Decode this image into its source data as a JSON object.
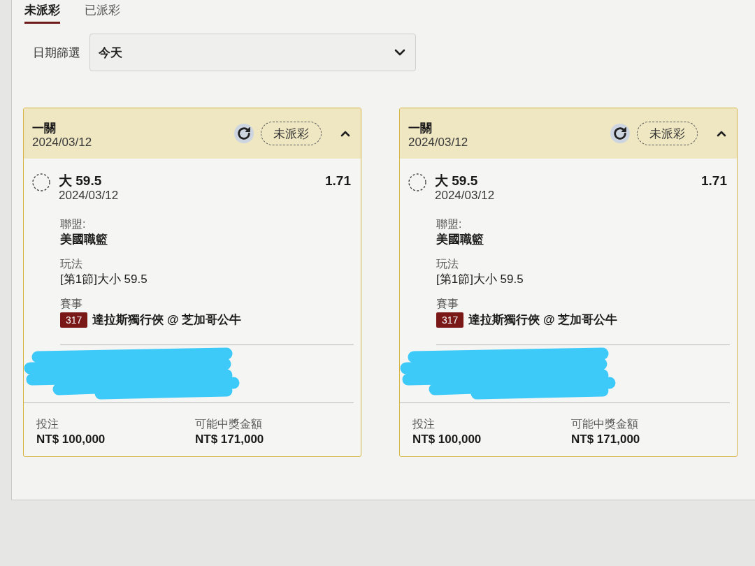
{
  "tabs": [
    {
      "label": "未派彩",
      "selected": true
    },
    {
      "label": "已派彩",
      "selected": false
    }
  ],
  "date_filter": {
    "label": "日期篩選",
    "value": "今天"
  },
  "bets": [
    {
      "title": "一關",
      "date": "2024/03/12",
      "status": "未派彩",
      "expanded": true,
      "selection": {
        "name": "大 59.5",
        "date": "2024/03/12",
        "odds": "1.71"
      },
      "details": [
        {
          "label": "聯盟:",
          "value": "美國職籃"
        },
        {
          "label": "玩法",
          "value": "[第1節]大小 59.5"
        },
        {
          "label": "賽事",
          "badge": "317",
          "value": "達拉斯獨行俠 @ 芝加哥公牛"
        }
      ],
      "redacted": true,
      "stake": {
        "label": "投注",
        "value": "NT$ 100,000"
      },
      "payout": {
        "label": "可能中獎金額",
        "value": "NT$ 171,000"
      }
    },
    {
      "title": "一關",
      "date": "2024/03/12",
      "status": "未派彩",
      "expanded": true,
      "selection": {
        "name": "大 59.5",
        "date": "2024/03/12",
        "odds": "1.71"
      },
      "details": [
        {
          "label": "聯盟:",
          "value": "美國職籃"
        },
        {
          "label": "玩法",
          "value": "[第1節]大小 59.5"
        },
        {
          "label": "賽事",
          "badge": "317",
          "value": "達拉斯獨行俠 @ 芝加哥公牛"
        }
      ],
      "redacted": true,
      "stake": {
        "label": "投注",
        "value": "NT$ 100,000"
      },
      "payout": {
        "label": "可能中獎金額",
        "value": "NT$ 171,000"
      }
    }
  ]
}
